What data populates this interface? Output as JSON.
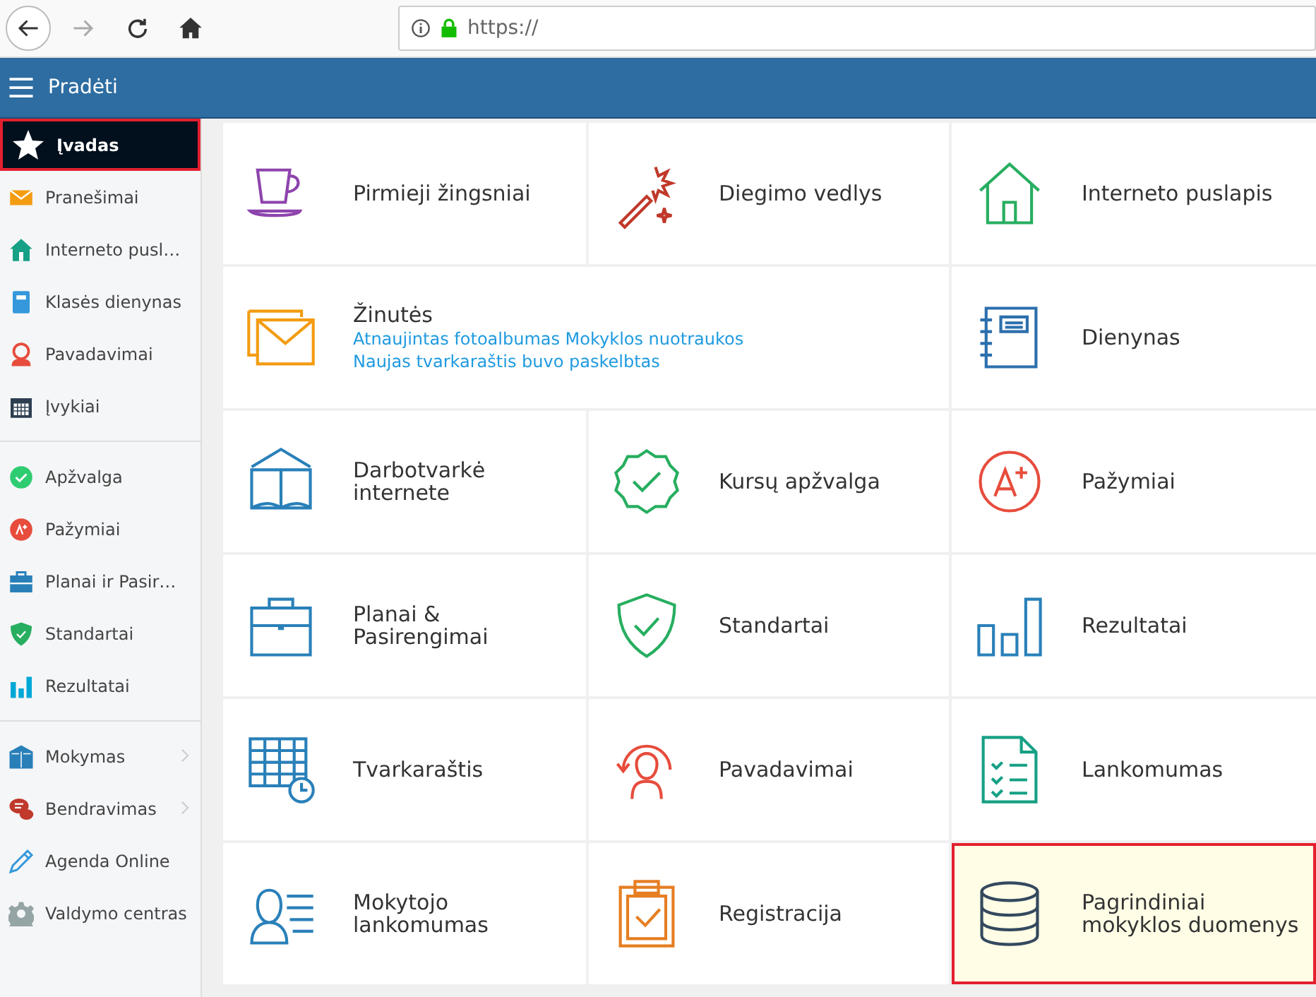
{
  "browser": {
    "url": "https://"
  },
  "header": {
    "title": "Pradėti"
  },
  "sidebar": {
    "groups": [
      {
        "items": [
          {
            "label": "Įvadas",
            "selected": true,
            "submenu": false
          },
          {
            "label": "Pranešimai",
            "selected": false,
            "submenu": false
          },
          {
            "label": "Interneto pusl…",
            "selected": false,
            "submenu": false
          },
          {
            "label": "Klasės dienynas",
            "selected": false,
            "submenu": false
          },
          {
            "label": "Pavadavimai",
            "selected": false,
            "submenu": false
          },
          {
            "label": "Įvykiai",
            "selected": false,
            "submenu": false
          }
        ]
      },
      {
        "items": [
          {
            "label": "Apžvalga",
            "selected": false,
            "submenu": false
          },
          {
            "label": "Pažymiai",
            "selected": false,
            "submenu": false
          },
          {
            "label": "Planai ir Pasir…",
            "selected": false,
            "submenu": false
          },
          {
            "label": "Standartai",
            "selected": false,
            "submenu": false
          },
          {
            "label": "Rezultatai",
            "selected": false,
            "submenu": false
          }
        ]
      },
      {
        "items": [
          {
            "label": "Mokymas",
            "selected": false,
            "submenu": true
          },
          {
            "label": "Bendravimas",
            "selected": false,
            "submenu": true
          },
          {
            "label": "Agenda Online",
            "selected": false,
            "submenu": false
          },
          {
            "label": "Valdymo centras",
            "selected": false,
            "submenu": false
          }
        ]
      }
    ]
  },
  "tiles": [
    {
      "title": "Pirmieji žingsniai",
      "selected": false,
      "wide": false
    },
    {
      "title": "Diegimo vedlys",
      "selected": false,
      "wide": false
    },
    {
      "title": "Interneto puslapis",
      "selected": false,
      "wide": false
    },
    {
      "title": "Žinutės",
      "selected": false,
      "wide": true,
      "links": [
        "Atnaujintas fotoalbumas Mokyklos nuotraukos",
        "Naujas tvarkaraštis buvo paskelbtas"
      ]
    },
    {
      "title": "Dienynas",
      "selected": false,
      "wide": false
    },
    {
      "title": "Darbotvarkė internete",
      "selected": false,
      "wide": false
    },
    {
      "title": "Kursų apžvalga",
      "selected": false,
      "wide": false
    },
    {
      "title": "Pažymiai",
      "selected": false,
      "wide": false
    },
    {
      "title": "Planai & Pasirengimai",
      "selected": false,
      "wide": false
    },
    {
      "title": "Standartai",
      "selected": false,
      "wide": false
    },
    {
      "title": "Rezultatai",
      "selected": false,
      "wide": false
    },
    {
      "title": "Tvarkaraštis",
      "selected": false,
      "wide": false
    },
    {
      "title": "Pavadavimai",
      "selected": false,
      "wide": false
    },
    {
      "title": "Lankomumas",
      "selected": false,
      "wide": false
    },
    {
      "title": "Mokytojo lankomumas",
      "selected": false,
      "wide": false
    },
    {
      "title": "Registracija",
      "selected": false,
      "wide": false
    },
    {
      "title": "Pagrindiniai mokyklos duomenys",
      "selected": true,
      "wide": false
    }
  ]
}
